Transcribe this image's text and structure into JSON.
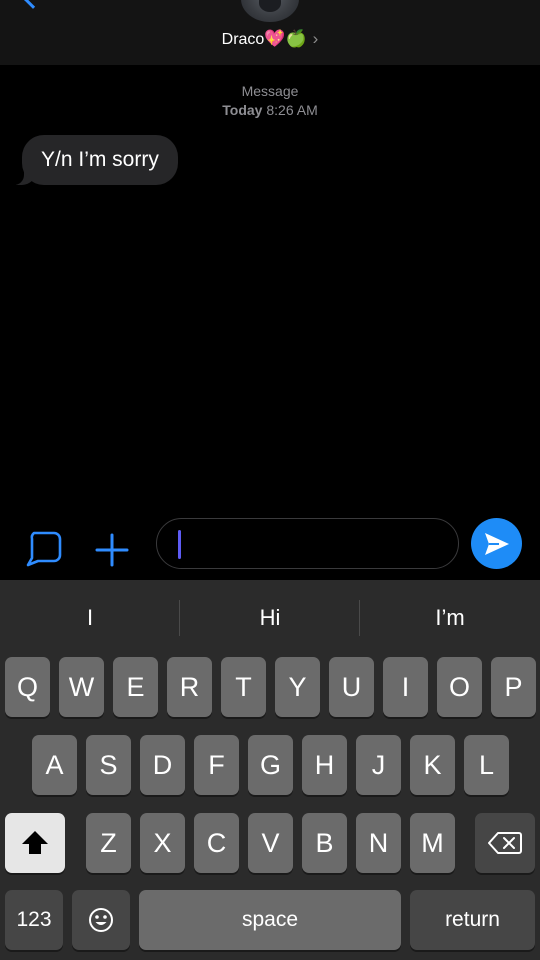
{
  "header": {
    "contact_name": "Draco",
    "contact_emojis": "💖🍏",
    "chevron": "›"
  },
  "thread": {
    "service": "Message",
    "day": "Today",
    "time": "8:26 AM",
    "messages": [
      {
        "from": "contact",
        "text": "Y/n I’m sorry"
      }
    ]
  },
  "input": {
    "value": "",
    "appstore_icon": "app-store-icon",
    "plus_icon": "plus-icon",
    "send_icon": "arrow-send-icon"
  },
  "keyboard": {
    "predictions": [
      "I",
      "Hi",
      "I’m"
    ],
    "row1": [
      "Q",
      "W",
      "E",
      "R",
      "T",
      "Y",
      "U",
      "I",
      "O",
      "P"
    ],
    "row2": [
      "A",
      "S",
      "D",
      "F",
      "G",
      "H",
      "J",
      "K",
      "L"
    ],
    "row3": [
      "Z",
      "X",
      "C",
      "V",
      "B",
      "N",
      "M"
    ],
    "numbers_label": "123",
    "space_label": "space",
    "return_label": "return",
    "shift_icon": "shift-icon",
    "delete_icon": "backspace-icon",
    "emoji_icon": "emoji-icon"
  },
  "colors": {
    "accent": "#1e8cf7",
    "bubble": "#262628",
    "keyboard_bg": "#2b2b2b",
    "key": "#6b6b6b"
  }
}
